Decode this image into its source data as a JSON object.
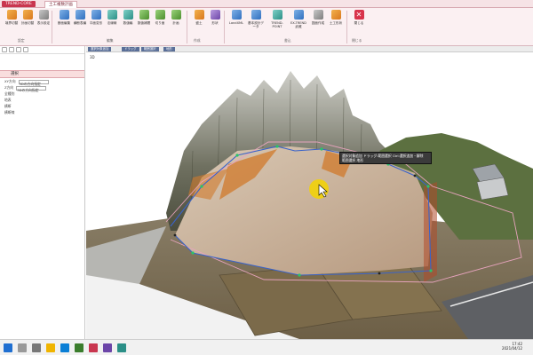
{
  "tabs": {
    "app": "TREND-CORE",
    "items": [
      "土工複数計画"
    ]
  },
  "ribbon": {
    "buttons": [
      {
        "label": "境界切替",
        "icon": "boundary-icon",
        "color": "orange"
      },
      {
        "label": "計画切替",
        "icon": "plan-switch-icon",
        "color": "orange"
      },
      {
        "label": "表示設定",
        "icon": "display-settings-icon",
        "color": "gray"
      },
      {
        "label": "断面編集",
        "icon": "section-edit-icon",
        "color": "blue"
      },
      {
        "label": "横断表編",
        "icon": "cross-section-icon",
        "color": "blue"
      },
      {
        "label": "平面変形",
        "icon": "plane-deform-icon",
        "color": "blue"
      },
      {
        "label": "法線線",
        "icon": "normal-line-icon",
        "color": "teal"
      },
      {
        "label": "数値編",
        "icon": "numeric-edit-icon",
        "color": "teal"
      },
      {
        "label": "数値補間",
        "icon": "interpolation-icon",
        "color": "green"
      },
      {
        "label": "切り面",
        "icon": "cut-surface-icon",
        "color": "green"
      },
      {
        "label": "計画",
        "icon": "plan-icon",
        "color": "green"
      },
      {
        "label": "盛土",
        "icon": "fill-icon",
        "color": "orange"
      },
      {
        "label": "形状",
        "icon": "shape-icon",
        "color": "purple"
      },
      {
        "label": "LandXML",
        "icon": "landxml-icon",
        "color": "blue"
      },
      {
        "label": "基本設計データ",
        "icon": "design-data-icon",
        "color": "blue"
      },
      {
        "label": "TREND-POINT",
        "icon": "trend-point-icon",
        "color": "teal"
      },
      {
        "label": "EX-TREND武蔵",
        "icon": "ex-trend-icon",
        "color": "blue"
      },
      {
        "label": "図面作成",
        "icon": "drawing-icon",
        "color": "gray"
      },
      {
        "label": "土工形状",
        "icon": "earthwork-icon",
        "color": "orange"
      },
      {
        "label": "閉じる",
        "icon": "close-icon",
        "color": "red"
      }
    ],
    "groups": [
      "設定",
      "編集",
      "作成",
      "書込",
      "閉じる"
    ]
  },
  "left_panel": {
    "header": "選択",
    "rows": [
      {
        "label": "XY方向",
        "value": "3Dの方向指定"
      },
      {
        "label": "Z方向",
        "value": "3Dの方向指定"
      },
      {
        "label": "全種別",
        "value": ""
      },
      {
        "label": "地表",
        "value": ""
      },
      {
        "label": "横断",
        "value": ""
      },
      {
        "label": "横断線",
        "value": ""
      }
    ]
  },
  "view": {
    "tabs": [
      "選択対象追加",
      "ドラッグ",
      "範囲選択",
      "地形"
    ],
    "label": "3D",
    "tooltip_lines": [
      "選択対象追加 ドラッグ:範囲選択 Ctrl:選択追加・解除",
      "範囲選択 地形"
    ]
  },
  "taskbar": {
    "time": "17:42",
    "date": "2021/04/12"
  },
  "colors": {
    "accent": "#c9364f",
    "ribbon_bg": "#fbf0f2",
    "selection_line": "#3a63c9",
    "cursor_highlight": "#f5d400"
  }
}
